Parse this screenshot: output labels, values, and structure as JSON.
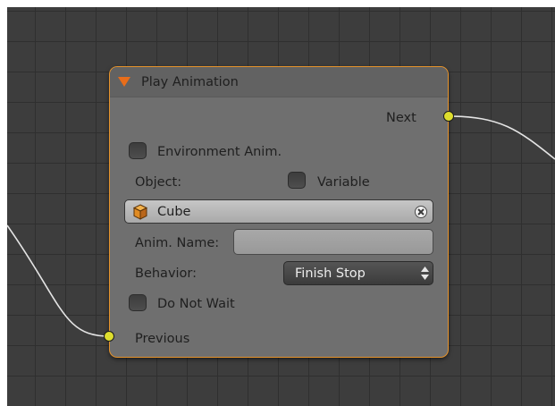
{
  "node": {
    "title": "Play Animation",
    "outputs": {
      "next": "Next"
    },
    "inputs": {
      "previous": "Previous"
    },
    "environment_anim": {
      "label": "Environment Anim.",
      "checked": false
    },
    "object": {
      "label": "Object:",
      "variable_label": "Variable",
      "variable_checked": false,
      "value": "Cube"
    },
    "anim_name": {
      "label": "Anim. Name:",
      "value": ""
    },
    "behavior": {
      "label": "Behavior:",
      "selected": "Finish Stop"
    },
    "do_not_wait": {
      "label": "Do Not Wait",
      "checked": false
    }
  },
  "colors": {
    "frame_accent": "#e6932b",
    "socket": "#dede2e",
    "canvas": "#3d3d3d",
    "node_body": "#6f6f6f"
  },
  "icons": {
    "collapse": "triangle-down-icon",
    "object": "cube-icon",
    "clear": "x-circle-icon",
    "select": "up-down-spinner-icon"
  }
}
